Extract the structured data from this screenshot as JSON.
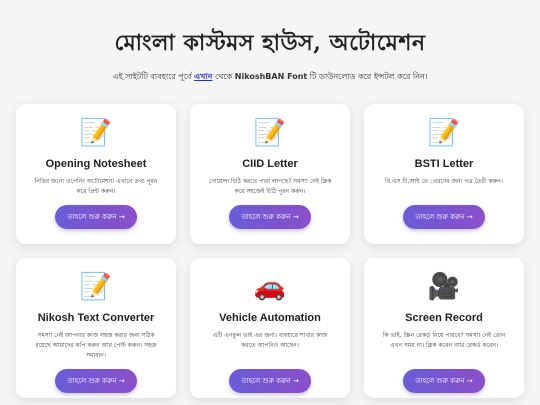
{
  "header": {
    "title": "মোংলা কাস্টমস হাউস, অটোমেশন",
    "subtitle_prefix": "এই সাইটটি ব্যবহারে পূর্বে",
    "subtitle_link": "এখান",
    "subtitle_mid": "থেকে",
    "subtitle_font": "NikoshBAN Font",
    "subtitle_suffix": "টি ডাউনলোড করে ইন্সটল করে নিন।"
  },
  "cards": [
    {
      "icon": "memo-icon",
      "glyph": "📝",
      "title": "Opening Notesheet",
      "description": "নিত্তির জন্যে ওপেনিং অটোমেশন। এখানে তথ্য পূরন করে প্রিন্ট করুন।",
      "button": "তাহলে শুরু করুন →"
    },
    {
      "icon": "memo-icon",
      "glyph": "📝",
      "title": "CIID Letter",
      "description": "গোয়েন্দা চিঠি করতে পারা লাগছে? সমস্যা নেই ক্লিক করে সহজেই চিঠি পূরন করুন।",
      "button": "তাহলে শুরু করুন →"
    },
    {
      "icon": "memo-icon",
      "glyph": "📝",
      "title": "BSTI Letter",
      "description": "বি.এস.টি.আই তে প্রেরণের জন্য পত্র তৈরী করুন।",
      "button": "তাহলে শুরু করুন →"
    },
    {
      "icon": "memo-icon",
      "glyph": "📝",
      "title": "Nikosh Text Converter",
      "description": "সমস্যা নেই আপনার কাজ সহজ করার জন্য সঠিক রয়েছে আমাদের কপি করুন আর পেস্ট করুন। সহজ সমাধান।",
      "button": "তাহলে শুরু করুন →"
    },
    {
      "icon": "car-icon",
      "glyph": "🚗",
      "title": "Vehicle Automation",
      "description": "এটি এনফুল ভাই এর জন্য। ব্যবহারে শাখার কাজ করতে আপনিও আছেন।",
      "button": "তাহলে শুরু করুন →"
    },
    {
      "icon": "movie-camera-icon",
      "glyph": "🎥",
      "title": "Screen Record",
      "description": "কি ভাই, স্ক্রিন রেকর্ড নিয়ে পারবে? সমস্যা নেই তোন এখন সময় না। ক্লিক করেন আর রেকর্ড করেন।",
      "button": "তাহলে শুরু করুন →"
    }
  ],
  "colors": {
    "background": "#f5f5f7",
    "button_gradient_start": "#6a5cd8",
    "button_gradient_end": "#8a4fc8",
    "link": "#2233cc"
  }
}
